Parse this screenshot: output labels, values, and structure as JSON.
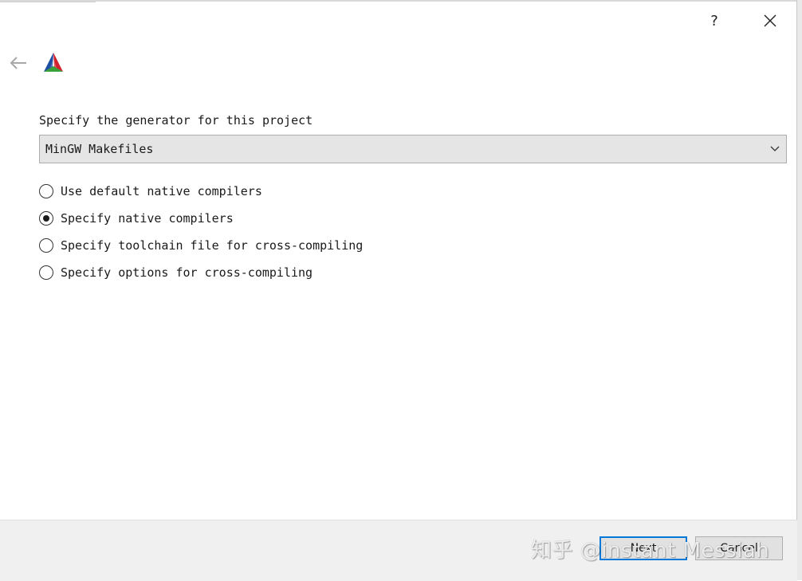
{
  "titlebar": {
    "help_label": "?",
    "close_label": "✕"
  },
  "header": {
    "back_icon": "arrow-left-icon",
    "logo_icon": "cmake-logo"
  },
  "generator": {
    "label": "Specify the generator for this project",
    "selected": "MinGW Makefiles"
  },
  "options": [
    {
      "label": "Use default native compilers",
      "checked": false
    },
    {
      "label": "Specify native compilers",
      "checked": true
    },
    {
      "label": "Specify toolchain file for cross-compiling",
      "checked": false
    },
    {
      "label": "Specify options for cross-compiling",
      "checked": false
    }
  ],
  "footer": {
    "next_label": "Next",
    "cancel_label": "Cancel"
  },
  "watermark": "知乎 @instant Messiah",
  "colors": {
    "accent": "#0078d7",
    "logo_red": "#d2222d",
    "logo_blue": "#1f4ea3",
    "logo_green": "#3aa03a"
  }
}
